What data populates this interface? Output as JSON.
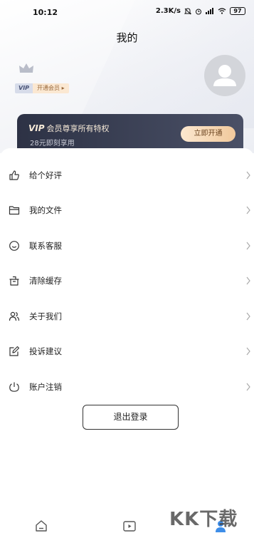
{
  "status_bar": {
    "time": "10:12",
    "net_speed": "2.3K/s",
    "battery": "97"
  },
  "page": {
    "title": "我的"
  },
  "profile": {
    "vip_label": "VIP",
    "open_label": "开通会员 ▸"
  },
  "vip_banner": {
    "brand": "VIP",
    "title": "会员尊享所有特权",
    "subtitle": "28元即刻享用",
    "button": "立即开通",
    "colors": {
      "bg_start": "#2d3245",
      "bg_end": "#4a5066",
      "gold": "#f1c99c"
    }
  },
  "menu": {
    "items": [
      {
        "label": "给个好评",
        "icon": "thumbs-up-icon"
      },
      {
        "label": "我的文件",
        "icon": "folder-icon"
      },
      {
        "label": "联系客服",
        "icon": "customer-service-icon"
      },
      {
        "label": "清除缓存",
        "icon": "clear-cache-icon"
      },
      {
        "label": "关于我们",
        "icon": "people-icon"
      },
      {
        "label": "投诉建议",
        "icon": "edit-icon"
      },
      {
        "label": "账户注销",
        "icon": "power-icon"
      }
    ]
  },
  "logout": {
    "label": "退出登录"
  },
  "tabs": [
    {
      "icon": "home-icon"
    },
    {
      "icon": "video-icon"
    },
    {
      "icon": "profile-icon",
      "active": true
    }
  ],
  "watermark": "KK下载"
}
